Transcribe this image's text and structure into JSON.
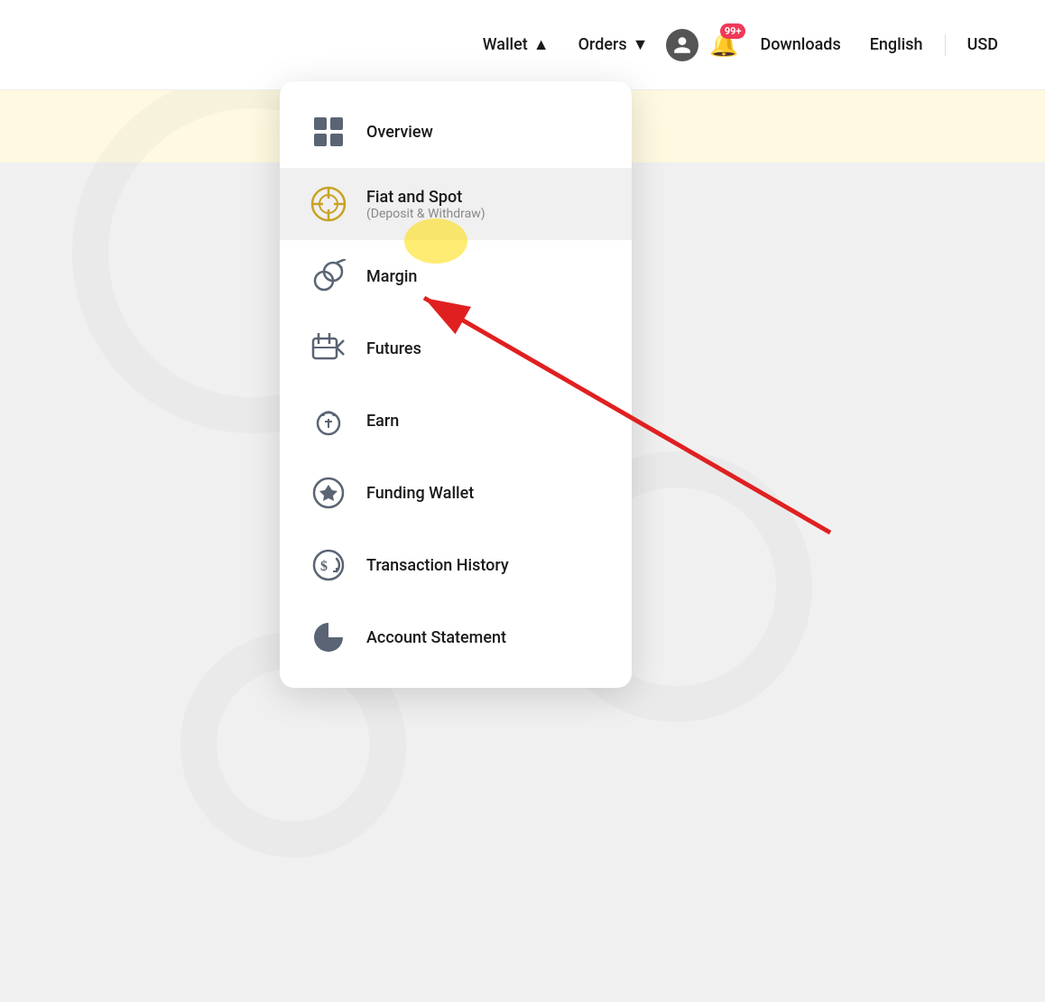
{
  "navbar": {
    "wallet_label": "Wallet",
    "orders_label": "Orders",
    "downloads_label": "Downloads",
    "english_label": "English",
    "usd_label": "USD",
    "notification_badge": "99+"
  },
  "menu": {
    "items": [
      {
        "id": "overview",
        "label": "Overview",
        "sublabel": ""
      },
      {
        "id": "fiat-and-spot",
        "label": "Fiat and Spot",
        "sublabel": "(Deposit & Withdraw)"
      },
      {
        "id": "margin",
        "label": "Margin",
        "sublabel": ""
      },
      {
        "id": "futures",
        "label": "Futures",
        "sublabel": ""
      },
      {
        "id": "earn",
        "label": "Earn",
        "sublabel": ""
      },
      {
        "id": "funding-wallet",
        "label": "Funding Wallet",
        "sublabel": ""
      },
      {
        "id": "transaction-history",
        "label": "Transaction History",
        "sublabel": ""
      },
      {
        "id": "account-statement",
        "label": "Account Statement",
        "sublabel": ""
      }
    ]
  }
}
